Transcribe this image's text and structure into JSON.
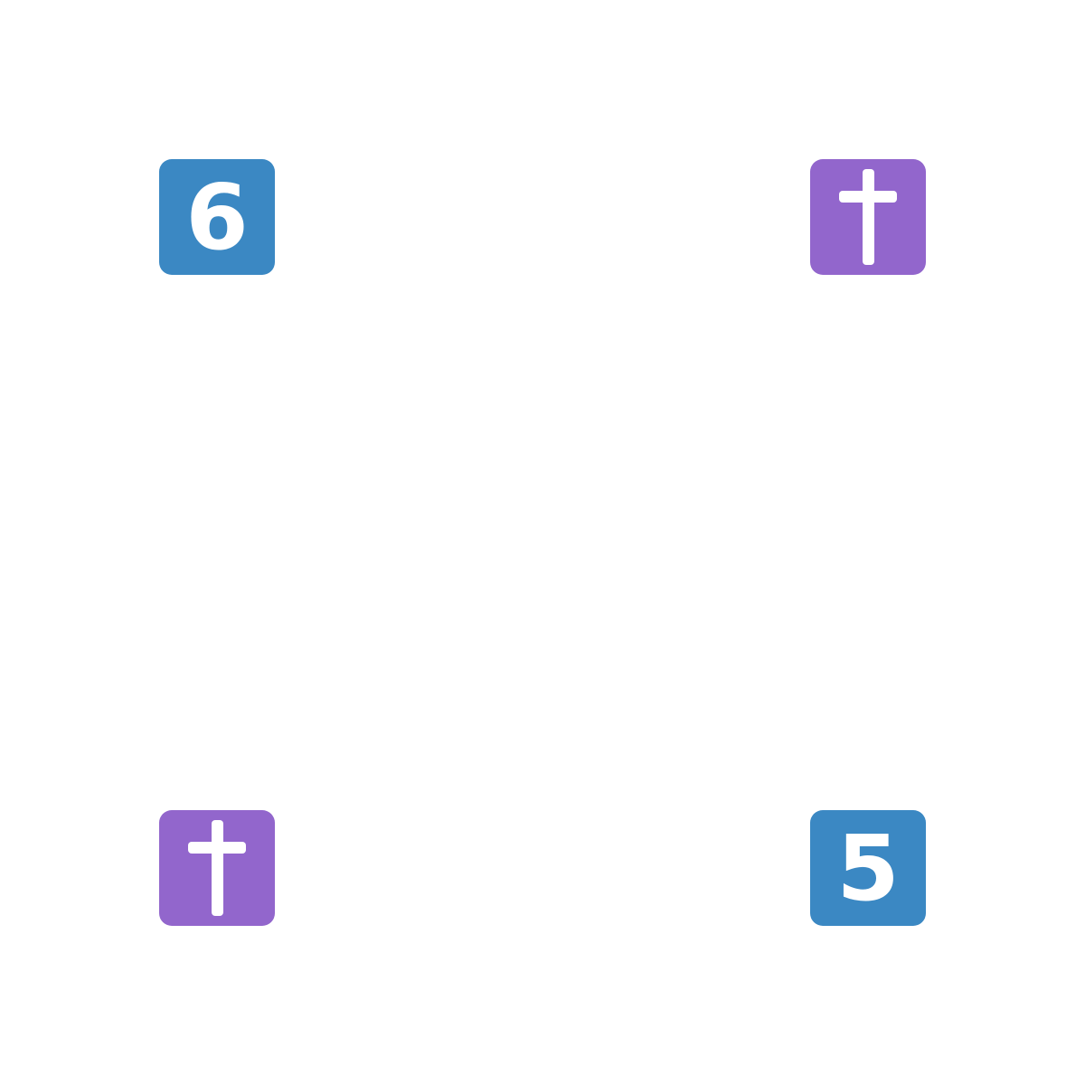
{
  "colors": {
    "digit_tile": "#3B88C3",
    "cross_tile": "#9266CC",
    "glyph": "#FFFFFF",
    "background": "#FFFFFF"
  },
  "tiles": [
    {
      "kind": "digit",
      "text": "6",
      "icon": "keycap-six-icon"
    },
    {
      "kind": "cross",
      "icon": "latin-cross-icon"
    },
    {
      "kind": "cross",
      "icon": "latin-cross-icon"
    },
    {
      "kind": "digit",
      "text": "5",
      "icon": "keycap-five-icon"
    }
  ]
}
